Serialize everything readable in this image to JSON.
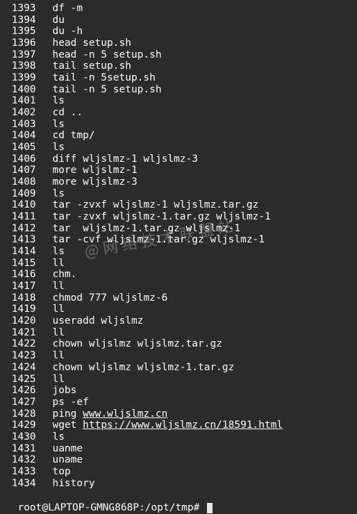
{
  "history": [
    {
      "n": "1393",
      "cmd": "df -m"
    },
    {
      "n": "1394",
      "cmd": "du"
    },
    {
      "n": "1395",
      "cmd": "du -h"
    },
    {
      "n": "1396",
      "cmd": "head setup.sh"
    },
    {
      "n": "1397",
      "cmd": "head -n 5 setup.sh"
    },
    {
      "n": "1398",
      "cmd": "tail setup.sh"
    },
    {
      "n": "1399",
      "cmd": "tail -n 5setup.sh"
    },
    {
      "n": "1400",
      "cmd": "tail -n 5 setup.sh"
    },
    {
      "n": "1401",
      "cmd": "ls"
    },
    {
      "n": "1402",
      "cmd": "cd .."
    },
    {
      "n": "1403",
      "cmd": "ls"
    },
    {
      "n": "1404",
      "cmd": "cd tmp/"
    },
    {
      "n": "1405",
      "cmd": "ls"
    },
    {
      "n": "1406",
      "cmd": "diff wljslmz-1 wljslmz-3"
    },
    {
      "n": "1407",
      "cmd": "more wljslmz-1"
    },
    {
      "n": "1408",
      "cmd": "more wljslmz-3"
    },
    {
      "n": "1409",
      "cmd": "ls"
    },
    {
      "n": "1410",
      "cmd": "tar -zvxf wljslmz-1 wljslmz.tar.gz"
    },
    {
      "n": "1411",
      "cmd": "tar -zvxf wljslmz-1.tar.gz wljslmz-1"
    },
    {
      "n": "1412",
      "cmd": "tar  wljslmz-1.tar.gz wljslmz-1"
    },
    {
      "n": "1413",
      "cmd": "tar -cvf wljslmz-1.tar.gz wljslmz-1"
    },
    {
      "n": "1414",
      "cmd": "ls"
    },
    {
      "n": "1415",
      "cmd": "ll"
    },
    {
      "n": "1416",
      "cmd": "chm."
    },
    {
      "n": "1417",
      "cmd": "ll"
    },
    {
      "n": "1418",
      "cmd": "chmod 777 wljslmz-6"
    },
    {
      "n": "1419",
      "cmd": "ll"
    },
    {
      "n": "1420",
      "cmd": "useradd wljslmz"
    },
    {
      "n": "1421",
      "cmd": "ll"
    },
    {
      "n": "1422",
      "cmd": "chown wljslmz wljslmz.tar.gz"
    },
    {
      "n": "1423",
      "cmd": "ll"
    },
    {
      "n": "1424",
      "cmd": "chown wljslmz wljslmz-1.tar.gz"
    },
    {
      "n": "1425",
      "cmd": "ll"
    },
    {
      "n": "1426",
      "cmd": "jobs"
    },
    {
      "n": "1427",
      "cmd": "ps -ef"
    },
    {
      "n": "1428",
      "cmd": "ping www.wljslmz.cn",
      "link": "www.wljslmz.cn",
      "prefix": "ping "
    },
    {
      "n": "1429",
      "cmd": "wget https://www.wljslmz.cn/18591.html",
      "link": "https://www.wljslmz.cn/18591.html",
      "prefix": "wget "
    },
    {
      "n": "1430",
      "cmd": "ls"
    },
    {
      "n": "1431",
      "cmd": "uanme"
    },
    {
      "n": "1432",
      "cmd": "uname"
    },
    {
      "n": "1433",
      "cmd": "top"
    },
    {
      "n": "1434",
      "cmd": "history"
    }
  ],
  "prompt": "root@LAPTOP-GMNG868P:/opt/tmp# ",
  "watermark": "@网络技术联盟站"
}
